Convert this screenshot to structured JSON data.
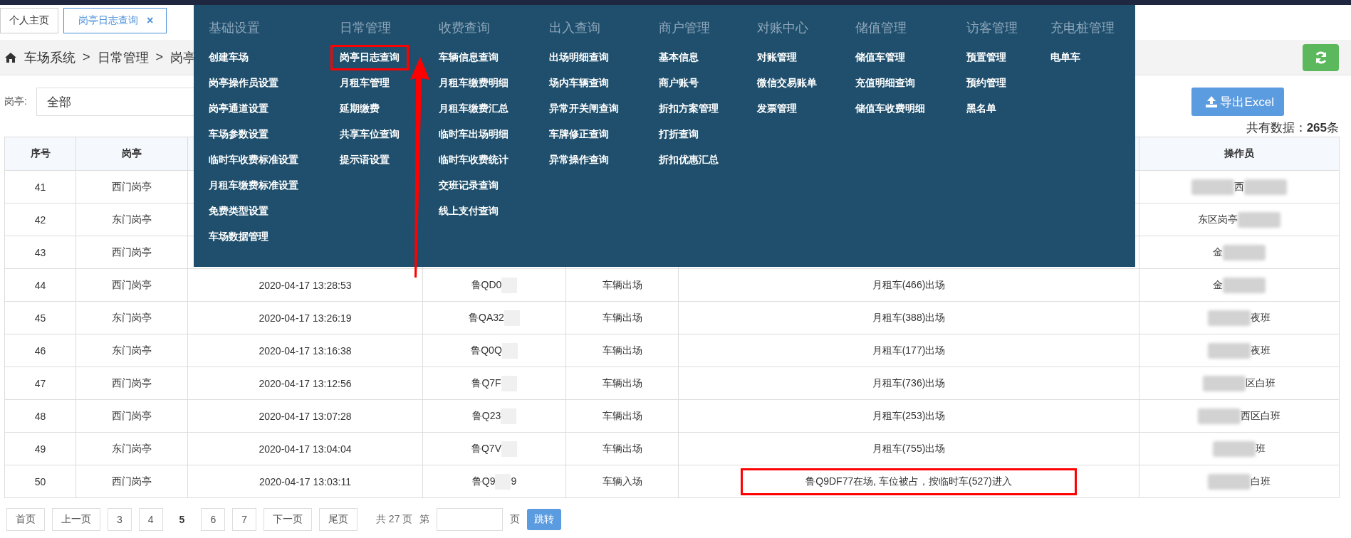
{
  "tabs": [
    {
      "label": "个人主页",
      "selected": false
    },
    {
      "label": "岗亭日志查询",
      "selected": true,
      "close": "×"
    }
  ],
  "breadcrumb": [
    "车场系统",
    "日常管理",
    "岗亭"
  ],
  "breadcrumb_separator": ">",
  "filter": {
    "label": "岗亭:",
    "value": "全部"
  },
  "export_button": "导出Excel",
  "count": {
    "prefix": "共有数据：",
    "value": "265",
    "suffix": "条"
  },
  "table": {
    "columns": [
      "序号",
      "岗亭",
      "操作员"
    ],
    "rows": [
      {
        "no": "41",
        "booth": "西门岗亭",
        "operator": {
          "text": "西",
          "blur_before": true,
          "blur_after": true
        }
      },
      {
        "no": "42",
        "booth": "东门岗亭",
        "operator": {
          "text": "东区岗亭",
          "blur_before": false,
          "blur_after": true
        }
      },
      {
        "no": "43",
        "booth": "西门岗亭",
        "operator": {
          "text": "金",
          "blur_before": false,
          "blur_after": true
        }
      },
      {
        "no": "44",
        "booth": "西门岗亭",
        "time": "2020-04-17 13:28:53",
        "plate": [
          "鲁QD0"
        ],
        "event": "车辆出场",
        "description": "月租车(466)出场",
        "highlighted": false,
        "operator": {
          "text": "金",
          "blur_before": false,
          "blur_after": true
        }
      },
      {
        "no": "45",
        "booth": "东门岗亭",
        "time": "2020-04-17 13:26:19",
        "plate": [
          "鲁QA32"
        ],
        "event": "车辆出场",
        "description": "月租车(388)出场",
        "highlighted": false,
        "operator": {
          "text": "夜班",
          "blur_before": true,
          "blur_after": false
        }
      },
      {
        "no": "46",
        "booth": "东门岗亭",
        "time": "2020-04-17 13:16:38",
        "plate": [
          "鲁Q0Q"
        ],
        "event": "车辆出场",
        "description": "月租车(177)出场",
        "highlighted": false,
        "operator": {
          "text": "夜班",
          "blur_before": true,
          "blur_after": false
        }
      },
      {
        "no": "47",
        "booth": "西门岗亭",
        "time": "2020-04-17 13:12:56",
        "plate": [
          "鲁Q7F"
        ],
        "event": "车辆出场",
        "description": "月租车(736)出场",
        "highlighted": false,
        "operator": {
          "text": "区白班",
          "blur_before": true,
          "blur_after": false
        }
      },
      {
        "no": "48",
        "booth": "西门岗亭",
        "time": "2020-04-17 13:07:28",
        "plate": [
          "鲁Q23"
        ],
        "event": "车辆出场",
        "description": "月租车(253)出场",
        "highlighted": false,
        "operator": {
          "text": "西区白班",
          "blur_before": true,
          "blur_after": false
        }
      },
      {
        "no": "49",
        "booth": "东门岗亭",
        "time": "2020-04-17 13:04:04",
        "plate": [
          "鲁Q7V"
        ],
        "event": "车辆出场",
        "description": "月租车(755)出场",
        "highlighted": false,
        "operator": {
          "text": "班",
          "blur_before": true,
          "blur_after": false
        }
      },
      {
        "no": "50",
        "booth": "西门岗亭",
        "time": "2020-04-17 13:03:11",
        "plate": [
          "鲁Q9",
          "9"
        ],
        "event": "车辆入场",
        "description": "鲁Q9DF77在场, 车位被占，按临时车(527)进入",
        "highlighted": true,
        "operator": {
          "text": "白班",
          "blur_before": true,
          "blur_after": false
        }
      }
    ]
  },
  "pagination": {
    "pages": [
      {
        "label": "首页",
        "selected": false
      },
      {
        "label": "上一页",
        "selected": false
      },
      {
        "label": "3",
        "selected": false
      },
      {
        "label": "4",
        "selected": false
      },
      {
        "label": "5",
        "selected": true
      },
      {
        "label": "6",
        "selected": false
      },
      {
        "label": "7",
        "selected": false
      },
      {
        "label": "下一页",
        "selected": false
      },
      {
        "label": "尾页",
        "selected": false
      }
    ],
    "total": "共 27 页",
    "goto_prefix": "第",
    "goto_suffix": "页",
    "goto_button": "跳转"
  },
  "menu": {
    "columns": [
      {
        "heading": "基础设置",
        "items": [
          {
            "label": "创建车场",
            "highlighted": false
          },
          {
            "label": "岗亭操作员设置",
            "highlighted": false
          },
          {
            "label": "岗亭通道设置",
            "highlighted": false
          },
          {
            "label": "车场参数设置",
            "highlighted": false
          },
          {
            "label": "临时车收费标准设置",
            "highlighted": false
          },
          {
            "label": "月租车缴费标准设置",
            "highlighted": false
          },
          {
            "label": "免费类型设置",
            "highlighted": false
          },
          {
            "label": "车场数据管理",
            "highlighted": false
          }
        ]
      },
      {
        "heading": "日常管理",
        "items": [
          {
            "label": "岗亭日志查询",
            "highlighted": true
          },
          {
            "label": "月租车管理",
            "highlighted": false
          },
          {
            "label": "延期缴费",
            "highlighted": false
          },
          {
            "label": "共享车位查询",
            "highlighted": false
          },
          {
            "label": "提示语设置",
            "highlighted": false
          }
        ]
      },
      {
        "heading": "收费查询",
        "items": [
          {
            "label": "车辆信息查询",
            "highlighted": false
          },
          {
            "label": "月租车缴费明细",
            "highlighted": false
          },
          {
            "label": "月租车缴费汇总",
            "highlighted": false
          },
          {
            "label": "临时车出场明细",
            "highlighted": false
          },
          {
            "label": "临时车收费统计",
            "highlighted": false
          },
          {
            "label": "交班记录查询",
            "highlighted": false
          },
          {
            "label": "线上支付查询",
            "highlighted": false
          }
        ]
      },
      {
        "heading": "出入查询",
        "items": [
          {
            "label": "出场明细查询",
            "highlighted": false
          },
          {
            "label": "场内车辆查询",
            "highlighted": false
          },
          {
            "label": "异常开关闸查询",
            "highlighted": false
          },
          {
            "label": "车牌修正查询",
            "highlighted": false
          },
          {
            "label": "异常操作查询",
            "highlighted": false
          }
        ]
      },
      {
        "heading": "商户管理",
        "items": [
          {
            "label": "基本信息",
            "highlighted": false
          },
          {
            "label": "商户账号",
            "highlighted": false
          },
          {
            "label": "折扣方案管理",
            "highlighted": false
          },
          {
            "label": "打折查询",
            "highlighted": false
          },
          {
            "label": "折扣优惠汇总",
            "highlighted": false
          }
        ]
      },
      {
        "heading": "对账中心",
        "items": [
          {
            "label": "对账管理",
            "highlighted": false
          },
          {
            "label": "微信交易账单",
            "highlighted": false
          },
          {
            "label": "发票管理",
            "highlighted": false
          }
        ]
      },
      {
        "heading": "储值管理",
        "items": [
          {
            "label": "储值车管理",
            "highlighted": false
          },
          {
            "label": "充值明细查询",
            "highlighted": false
          },
          {
            "label": "储值车收费明细",
            "highlighted": false
          }
        ]
      },
      {
        "heading": "访客管理",
        "items": [
          {
            "label": "预置管理",
            "highlighted": false
          },
          {
            "label": "预约管理",
            "highlighted": false
          },
          {
            "label": "黑名单",
            "highlighted": false
          }
        ]
      },
      {
        "heading": "充电桩管理",
        "items": [
          {
            "label": "电单车",
            "highlighted": false
          }
        ]
      }
    ]
  }
}
